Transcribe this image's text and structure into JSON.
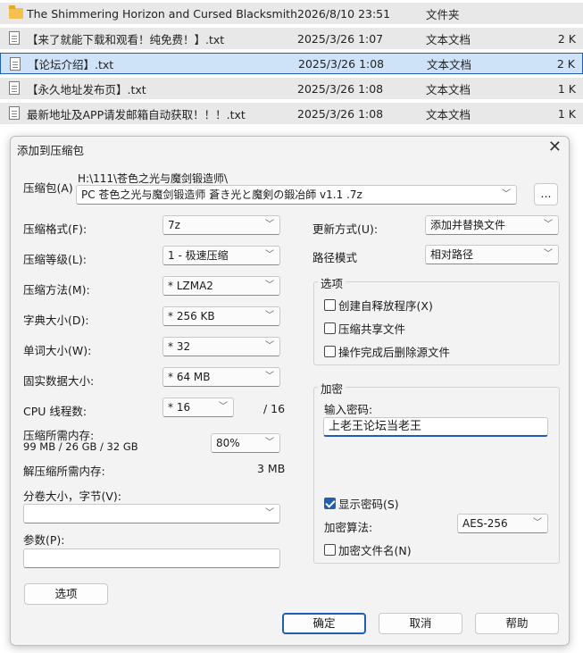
{
  "files": [
    {
      "name": "The Shimmering Horizon and Cursed Blacksmith",
      "date": "2026/8/10 23:51",
      "type": "文件夹",
      "size": "",
      "icon": "folder-icon",
      "selected": false
    },
    {
      "name": "【来了就能下载和观看！纯免费！】.txt",
      "date": "2025/3/26 1:07",
      "type": "文本文档",
      "size": "2 K",
      "icon": "text-file-icon",
      "selected": false
    },
    {
      "name": "【论坛介绍】.txt",
      "date": "2025/3/26 1:08",
      "type": "文本文档",
      "size": "2 K",
      "icon": "text-file-icon",
      "selected": true
    },
    {
      "name": "【永久地址发布页】.txt",
      "date": "2025/3/26 1:08",
      "type": "文本文档",
      "size": "1 K",
      "icon": "text-file-icon",
      "selected": false
    },
    {
      "name": "最新地址及APP请发邮箱自动获取！！！.txt",
      "date": "2025/3/26 1:08",
      "type": "文本文档",
      "size": "1 K",
      "icon": "text-file-icon",
      "selected": false
    }
  ],
  "dialog": {
    "title": "添加到压缩包",
    "close": "✕",
    "archive_label": "压缩包(A)",
    "archive_dir": "H:\\111\\苍色之光与魔剑锻造师\\",
    "archive_name": "PC 苍色之光与魔剑锻造师 蒼き光と魔剣の鍛冶師 v1.1 .7z",
    "browse": "...",
    "left": {
      "format_label": "压缩格式(F):",
      "format_value": "7z",
      "level_label": "压缩等级(L):",
      "level_value": "1 - 极速压缩",
      "method_label": "压缩方法(M):",
      "method_value": "* LZMA2",
      "dict_label": "字典大小(D):",
      "dict_value": "* 256 KB",
      "word_label": "单词大小(W):",
      "word_value": "* 32",
      "solid_label": "固实数据大小:",
      "solid_value": "* 64 MB",
      "cpu_label": "CPU 线程数:",
      "cpu_value": "* 16",
      "cpu_total": "/ 16",
      "mem_label": "压缩所需内存:",
      "mem_detail": "99 MB / 26 GB / 32 GB",
      "mem_value": "80%",
      "decomp_label": "解压缩所需内存:",
      "decomp_value": "3 MB",
      "split_label": "分卷大小，字节(V):",
      "split_value": "",
      "params_label": "参数(P):",
      "params_value": "",
      "options_button": "选项"
    },
    "right": {
      "update_label": "更新方式(U):",
      "update_value": "添加并替换文件",
      "path_label": "路径模式",
      "path_value": "相对路径",
      "options_group": "选项",
      "sfx": "创建自释放程序(X)",
      "shared": "压缩共享文件",
      "delete_after": "操作完成后删除源文件",
      "encrypt_group": "加密",
      "password_label": "输入密码:",
      "password_value": "上老王论坛当老王",
      "show_password": "显示密码(S)",
      "algo_label": "加密算法:",
      "algo_value": "AES-256",
      "encrypt_names": "加密文件名(N)"
    },
    "buttons": {
      "ok": "确定",
      "cancel": "取消",
      "help": "帮助"
    }
  },
  "colors": {
    "accent": "#1e5fb4",
    "dialog_bg": "#f3f3f3",
    "row_bg": "#e8e8e8",
    "row_selected": "#cfe3f8"
  }
}
